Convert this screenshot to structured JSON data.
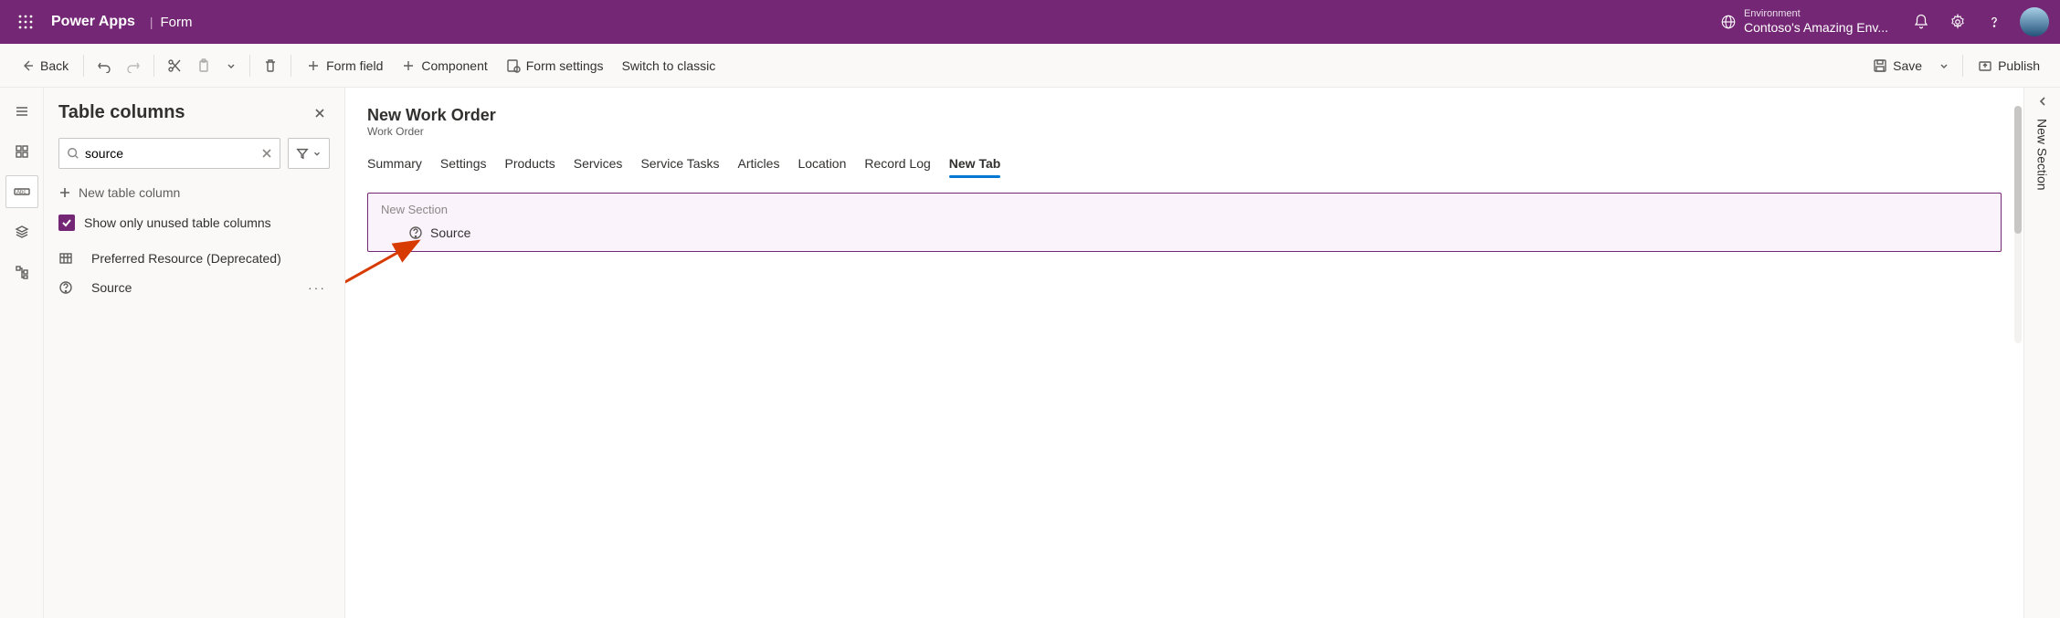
{
  "header": {
    "app_title": "Power Apps",
    "breadcrumb": "Form",
    "env_label": "Environment",
    "env_name": "Contoso's Amazing Env..."
  },
  "commands": {
    "back": "Back",
    "form_field": "Form field",
    "component": "Component",
    "form_settings": "Form settings",
    "switch_classic": "Switch to classic",
    "save": "Save",
    "publish": "Publish"
  },
  "panel": {
    "title": "Table columns",
    "search_value": "source",
    "new_column": "New table column",
    "show_unused": "Show only unused table columns",
    "items": [
      {
        "label": "Preferred Resource (Deprecated)",
        "icon": "table"
      },
      {
        "label": "Source",
        "icon": "question"
      }
    ]
  },
  "form": {
    "title": "New Work Order",
    "subtitle": "Work Order",
    "tabs": [
      "Summary",
      "Settings",
      "Products",
      "Services",
      "Service Tasks",
      "Articles",
      "Location",
      "Record Log",
      "New Tab"
    ],
    "active_tab": "New Tab",
    "section_label": "New Section",
    "field_label": "Source"
  },
  "right_panel": {
    "label": "New Section"
  }
}
